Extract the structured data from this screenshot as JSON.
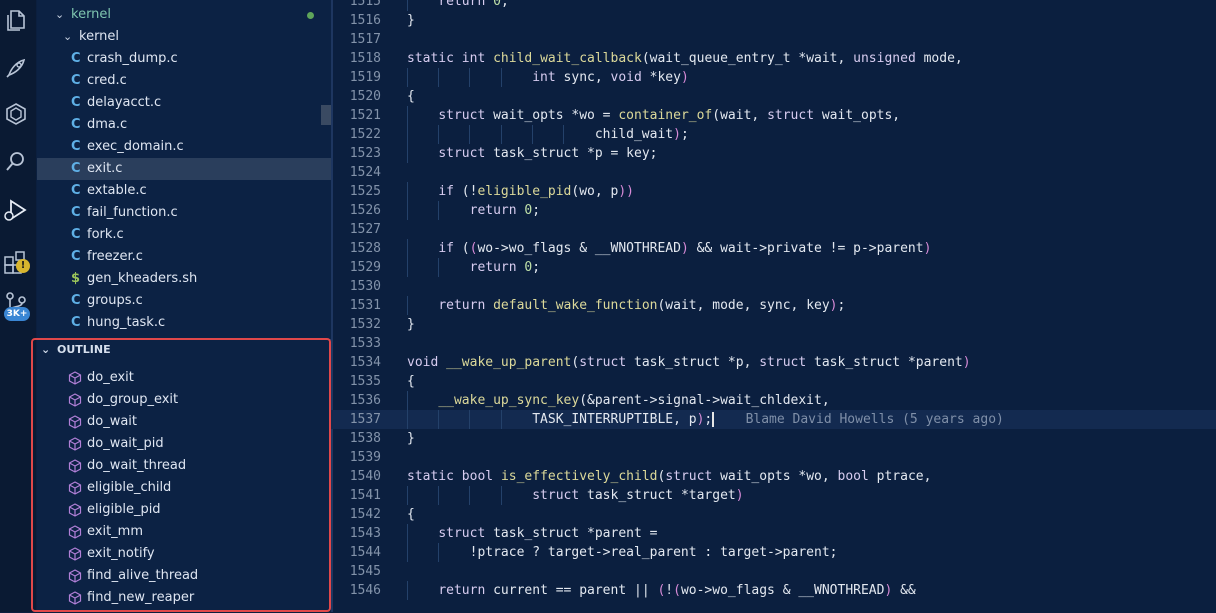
{
  "explorer": {
    "folders": [
      {
        "label": "kernel",
        "modified": true
      },
      {
        "label": "kernel"
      }
    ],
    "files": [
      {
        "icon": "C",
        "label": "crash_dump.c"
      },
      {
        "icon": "C",
        "label": "cred.c"
      },
      {
        "icon": "C",
        "label": "delayacct.c"
      },
      {
        "icon": "C",
        "label": "dma.c"
      },
      {
        "icon": "C",
        "label": "exec_domain.c"
      },
      {
        "icon": "C",
        "label": "exit.c",
        "selected": true
      },
      {
        "icon": "C",
        "label": "extable.c"
      },
      {
        "icon": "C",
        "label": "fail_function.c"
      },
      {
        "icon": "C",
        "label": "fork.c"
      },
      {
        "icon": "C",
        "label": "freezer.c"
      },
      {
        "icon": "$",
        "label": "gen_kheaders.sh"
      },
      {
        "icon": "C",
        "label": "groups.c"
      },
      {
        "icon": "C",
        "label": "hung_task.c"
      }
    ]
  },
  "activity_bar": {
    "icons": [
      "explorer-icon",
      "rocket-icon",
      "extensions-hex-icon",
      "search-icon",
      "run-debug-icon",
      "extensions-blocks-icon",
      "source-control-icon"
    ],
    "warning_badge": "!",
    "source_control_badge": "3K+"
  },
  "outline": {
    "title": "OUTLINE",
    "items": [
      "do_exit",
      "do_group_exit",
      "do_wait",
      "do_wait_pid",
      "do_wait_thread",
      "eligible_child",
      "eligible_pid",
      "exit_mm",
      "exit_notify",
      "find_alive_thread",
      "find_new_reaper"
    ]
  },
  "editor": {
    "lines": [
      {
        "n": "1515",
        "text": "    return 0;"
      },
      {
        "n": "1516",
        "text": "}"
      },
      {
        "n": "1517",
        "text": ""
      },
      {
        "n": "1518",
        "text": "static int child_wait_callback(wait_queue_entry_t *wait, unsigned mode,"
      },
      {
        "n": "1519",
        "text": "                int sync, void *key)"
      },
      {
        "n": "1520",
        "text": "{"
      },
      {
        "n": "1521",
        "text": "    struct wait_opts *wo = container_of(wait, struct wait_opts,"
      },
      {
        "n": "1522",
        "text": "                        child_wait);"
      },
      {
        "n": "1523",
        "text": "    struct task_struct *p = key;"
      },
      {
        "n": "1524",
        "text": ""
      },
      {
        "n": "1525",
        "text": "    if (!eligible_pid(wo, p))"
      },
      {
        "n": "1526",
        "text": "        return 0;"
      },
      {
        "n": "1527",
        "text": ""
      },
      {
        "n": "1528",
        "text": "    if ((wo->wo_flags & __WNOTHREAD) && wait->private != p->parent)"
      },
      {
        "n": "1529",
        "text": "        return 0;"
      },
      {
        "n": "1530",
        "text": ""
      },
      {
        "n": "1531",
        "text": "    return default_wake_function(wait, mode, sync, key);"
      },
      {
        "n": "1532",
        "text": "}"
      },
      {
        "n": "1533",
        "text": ""
      },
      {
        "n": "1534",
        "text": "void __wake_up_parent(struct task_struct *p, struct task_struct *parent)"
      },
      {
        "n": "1535",
        "text": "{"
      },
      {
        "n": "1536",
        "text": "    __wake_up_sync_key(&parent->signal->wait_chldexit,"
      },
      {
        "n": "1537",
        "text": "                TASK_INTERRUPTIBLE, p);",
        "blame": "Blame David Howells (5 years ago)",
        "current": true
      },
      {
        "n": "1538",
        "text": "}"
      },
      {
        "n": "1539",
        "text": ""
      },
      {
        "n": "1540",
        "text": "static bool is_effectively_child(struct wait_opts *wo, bool ptrace,"
      },
      {
        "n": "1541",
        "text": "                struct task_struct *target)"
      },
      {
        "n": "1542",
        "text": "{"
      },
      {
        "n": "1543",
        "text": "    struct task_struct *parent ="
      },
      {
        "n": "1544",
        "text": "        !ptrace ? target->real_parent : target->parent;"
      },
      {
        "n": "1545",
        "text": ""
      },
      {
        "n": "1546",
        "text": "    return current == parent || (!(wo->wo_flags & __WNOTHREAD) &&"
      }
    ]
  }
}
